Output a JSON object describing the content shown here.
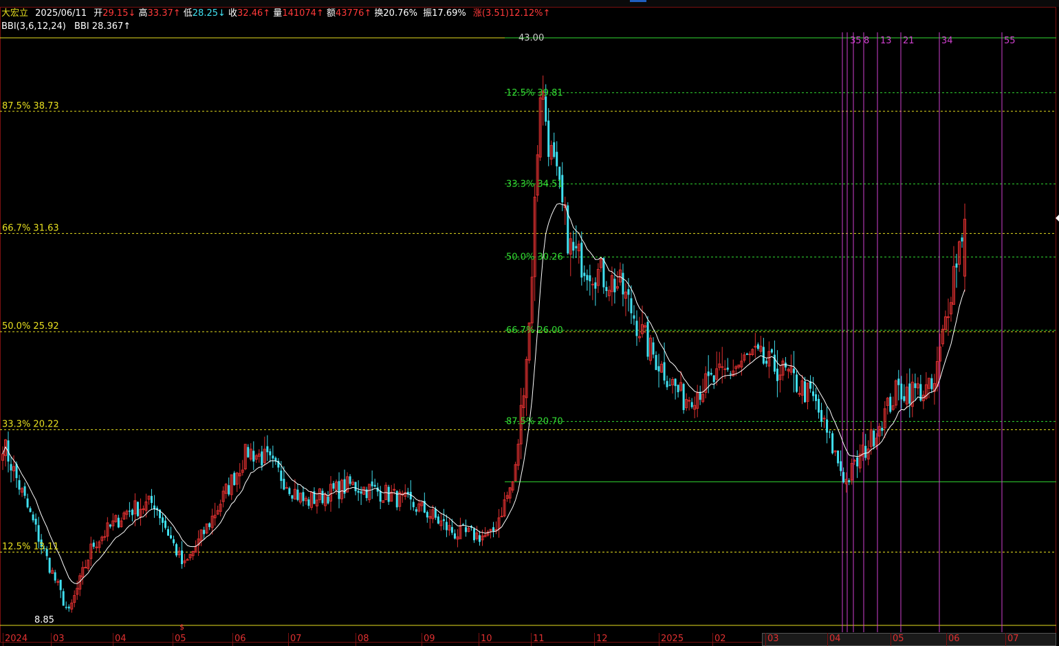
{
  "header": {
    "stock_name": "大宏立",
    "date": "2025/06/11",
    "open_label": "开",
    "open_value": "29.15↓",
    "high_label": "高",
    "high_value": "33.37↑",
    "low_label": "低",
    "low_value": "28.25↓",
    "close_label": "收",
    "close_value": "32.46↑",
    "volume_label": "量",
    "volume_value": "141074↑",
    "amount_label": "额",
    "amount_value": "43776↑",
    "turnover_label": "换",
    "turnover_value": "20.76%",
    "amplitude_label": "振",
    "amplitude_value": "17.69%",
    "change_label": "涨",
    "change_value": "(3.51)12.12%↑"
  },
  "indicator": {
    "name": "BBI(3,6,12,24)",
    "value_label": "BBI",
    "value": "28.367↑"
  },
  "colors": {
    "up": "#e03030",
    "down": "#40e0f0",
    "bbi": "#ffffff",
    "fib_left": "#e8e020",
    "fib_right": "#33dd33",
    "gann": "#d040d0",
    "header_name": "#e8e020",
    "text_white": "#ffffff",
    "text_red": "#ff3a3a",
    "text_cyan": "#40e0f0"
  },
  "price_markers": {
    "high_mark": "43.00",
    "low_mark": "8.85",
    "event_mark": "$"
  },
  "fib_left": [
    {
      "label": "87.5% 38.73"
    },
    {
      "label": "66.7% 31.63"
    },
    {
      "label": "50.0% 25.92"
    },
    {
      "label": "33.3% 20.22"
    },
    {
      "label": "12.5% 13.11"
    }
  ],
  "fib_right": [
    {
      "label": "12.5% 39.81"
    },
    {
      "label": "33.3% 34.51"
    },
    {
      "label": "50.0% 30.26"
    },
    {
      "label": "66.7% 26.00"
    },
    {
      "label": "87.5% 20.70"
    }
  ],
  "gann_labels": [
    "35",
    "8",
    "13",
    "21",
    "34",
    "55"
  ],
  "x_axis": [
    "2024",
    "03",
    "04",
    "05",
    "06",
    "07",
    "08",
    "09",
    "10",
    "11",
    "12",
    "2025",
    "02",
    "03",
    "04",
    "05",
    "06",
    "07"
  ],
  "chart_data": {
    "type": "candlestick",
    "title": "",
    "y_range": [
      8.85,
      43.0
    ],
    "series_names": [
      "BBI"
    ],
    "anchors": [
      {
        "date": "2024-01-02",
        "close": 19.5
      },
      {
        "date": "2024-01-25",
        "close": 13.0
      },
      {
        "date": "2024-02-07",
        "close": 9.5
      },
      {
        "date": "2024-02-20",
        "close": 13.5
      },
      {
        "date": "2024-03-10",
        "close": 15.5
      },
      {
        "date": "2024-03-25",
        "close": 16.0
      },
      {
        "date": "2024-04-10",
        "close": 12.2
      },
      {
        "date": "2024-04-25",
        "close": 15.0
      },
      {
        "date": "2024-05-15",
        "close": 19.0
      },
      {
        "date": "2024-05-25",
        "close": 18.5
      },
      {
        "date": "2024-06-15",
        "close": 16.0
      },
      {
        "date": "2024-07-10",
        "close": 17.0
      },
      {
        "date": "2024-07-30",
        "close": 16.5
      },
      {
        "date": "2024-08-20",
        "close": 15.5
      },
      {
        "date": "2024-09-05",
        "close": 14.2
      },
      {
        "date": "2024-09-25",
        "close": 14.0
      },
      {
        "date": "2024-10-08",
        "close": 17.5
      },
      {
        "date": "2024-10-16",
        "close": 26.5
      },
      {
        "date": "2024-10-22",
        "close": 40.5
      },
      {
        "date": "2024-10-28",
        "close": 36.0
      },
      {
        "date": "2024-11-08",
        "close": 30.5
      },
      {
        "date": "2024-11-20",
        "close": 29.5
      },
      {
        "date": "2024-12-05",
        "close": 28.5
      },
      {
        "date": "2024-12-20",
        "close": 25.0
      },
      {
        "date": "2025-01-08",
        "close": 22.0
      },
      {
        "date": "2025-01-28",
        "close": 23.3
      },
      {
        "date": "2025-02-15",
        "close": 24.5
      },
      {
        "date": "2025-03-05",
        "close": 23.5
      },
      {
        "date": "2025-03-20",
        "close": 22.0
      },
      {
        "date": "2025-04-07",
        "close": 17.2
      },
      {
        "date": "2025-04-20",
        "close": 19.5
      },
      {
        "date": "2025-05-05",
        "close": 22.5
      },
      {
        "date": "2025-05-25",
        "close": 22.5
      },
      {
        "date": "2025-06-05",
        "close": 29.5
      },
      {
        "date": "2025-06-11",
        "close": 32.46
      }
    ],
    "last_bar": {
      "date": "2025-06-11",
      "open": 29.15,
      "high": 33.37,
      "low": 28.25,
      "close": 32.46
    },
    "bbi_last": 28.367
  }
}
